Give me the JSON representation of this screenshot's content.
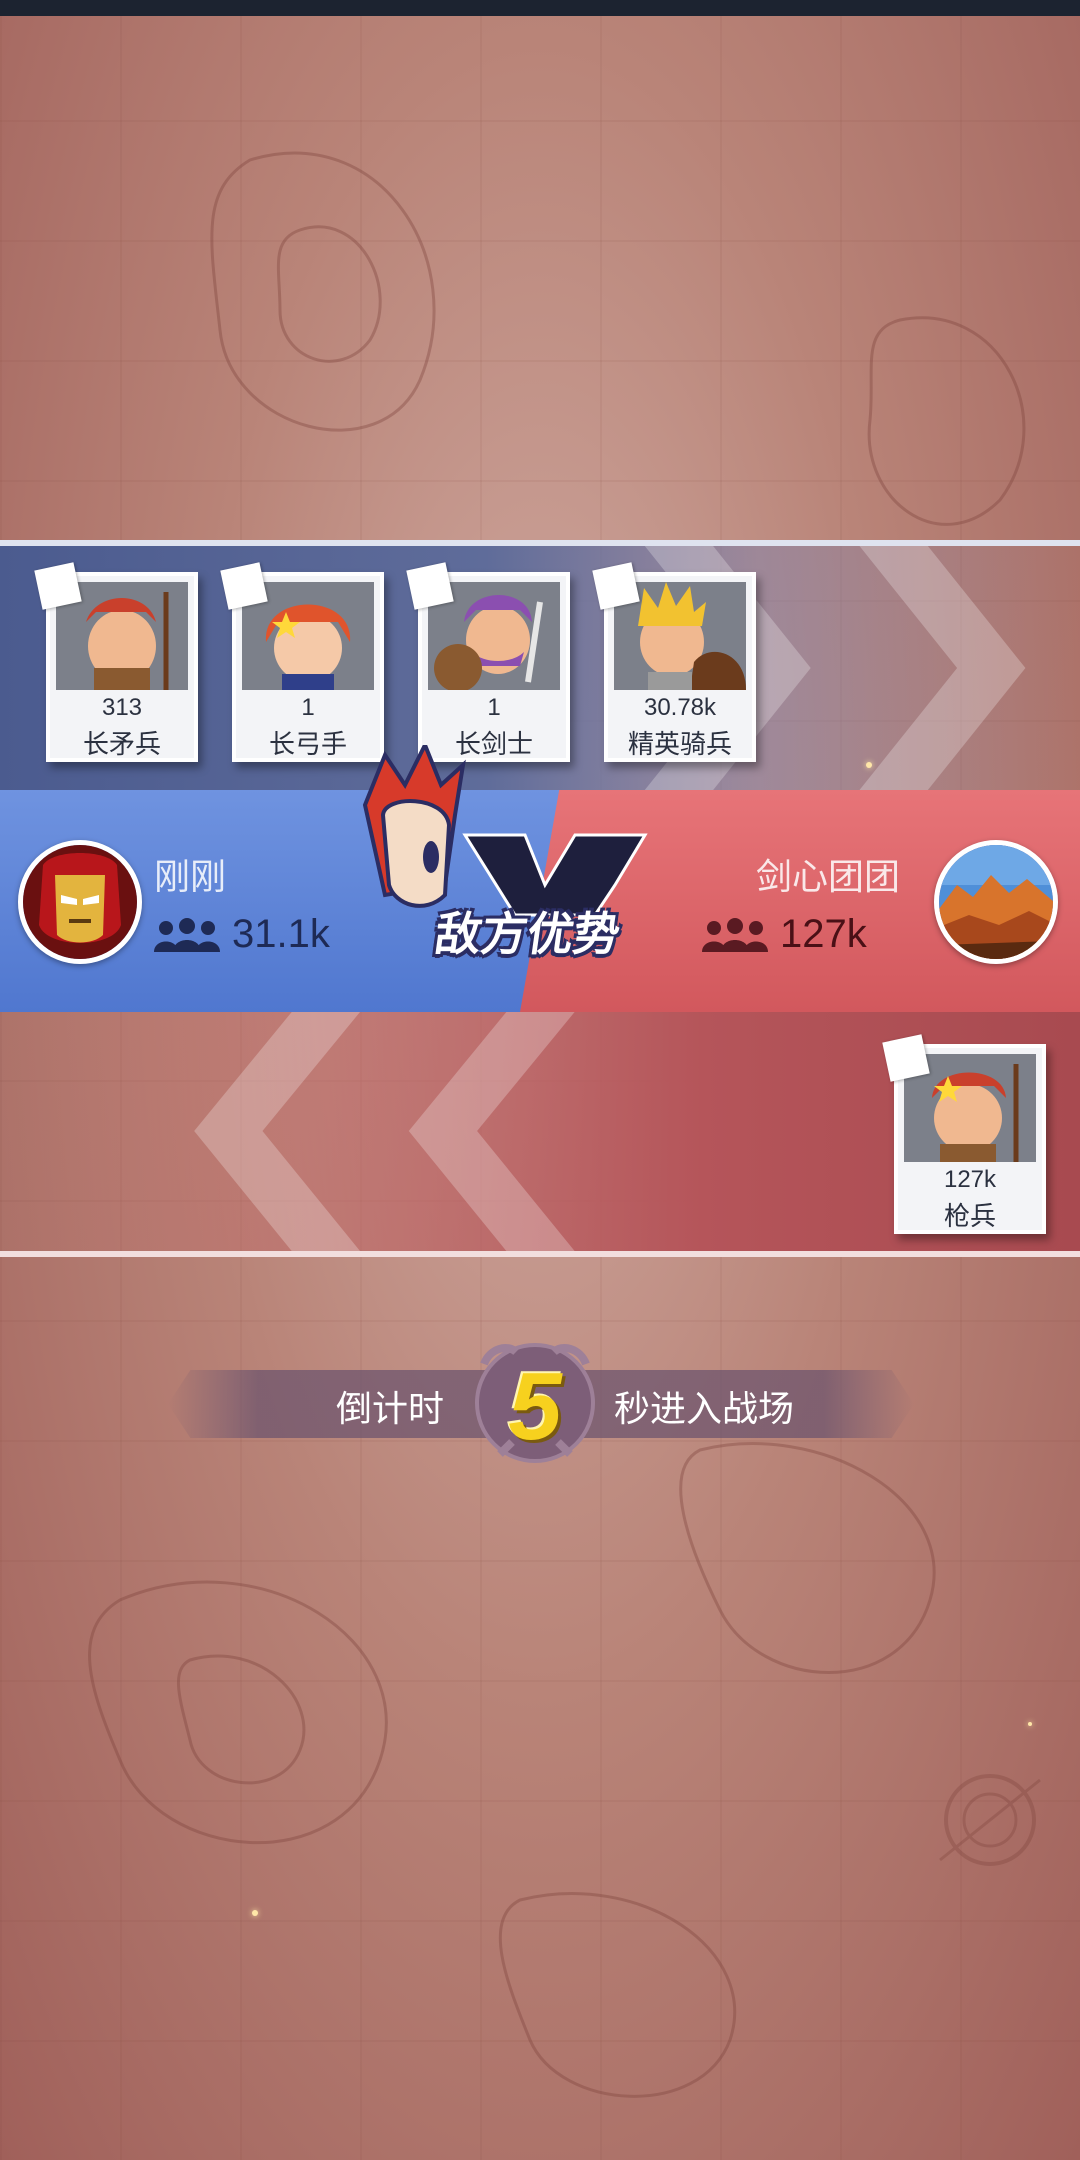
{
  "ally_units": [
    {
      "count": "313",
      "name": "长矛兵",
      "icon": "spear-icon"
    },
    {
      "count": "1",
      "name": "长弓手",
      "icon": "bow-icon"
    },
    {
      "count": "1",
      "name": "长剑士",
      "icon": "sword-icon"
    },
    {
      "count": "30.78k",
      "name": "精英骑兵",
      "icon": "spear-icon"
    }
  ],
  "enemy_units": [
    {
      "count": "127k",
      "name": "枪兵",
      "icon": "spear-icon"
    }
  ],
  "ally_player": {
    "name": "刚刚",
    "troops": "31.1k"
  },
  "enemy_player": {
    "name": "剑心团团",
    "troops": "127k"
  },
  "battle_status": "敌方优势",
  "countdown": {
    "prefix": "倒计时",
    "seconds": "5",
    "suffix": "秒进入战场"
  },
  "colors": {
    "ally": "#5a7fd6",
    "enemy": "#dc6468",
    "countdown": "#f7d11e"
  }
}
